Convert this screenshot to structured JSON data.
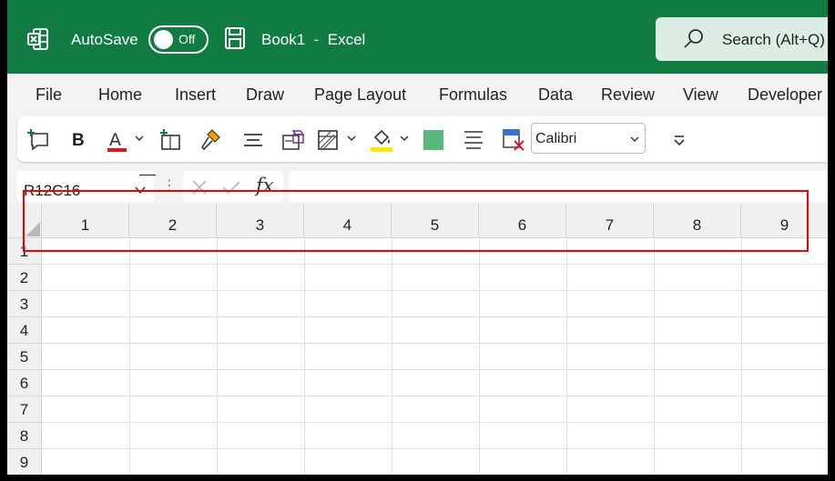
{
  "titlebar": {
    "autosave_label": "AutoSave",
    "autosave_state": "Off",
    "document_title": "Book1  -  Excel",
    "search_placeholder": "Search (Alt+Q)",
    "accent_color": "#107c41"
  },
  "menu": {
    "tabs": [
      "File",
      "Home",
      "Insert",
      "Draw",
      "Page Layout",
      "Formulas",
      "Data",
      "Review",
      "View",
      "Developer"
    ]
  },
  "toolbar": {
    "bold_label": "B",
    "font_color_letter": "A",
    "font_name": "Calibri",
    "font_color": "#e81123",
    "highlight_color": "#ffeb00",
    "fill_swatch_color": "#58b77a"
  },
  "formula_bar": {
    "name_box": "R12C16",
    "fx_label": "fx",
    "formula_value": ""
  },
  "grid": {
    "columns": [
      "1",
      "2",
      "3",
      "4",
      "5",
      "6",
      "7",
      "8",
      "9"
    ],
    "rows": [
      "1",
      "2",
      "3",
      "4",
      "5",
      "6",
      "7",
      "8",
      "9"
    ]
  },
  "annotation": {
    "color": "#e00000"
  }
}
